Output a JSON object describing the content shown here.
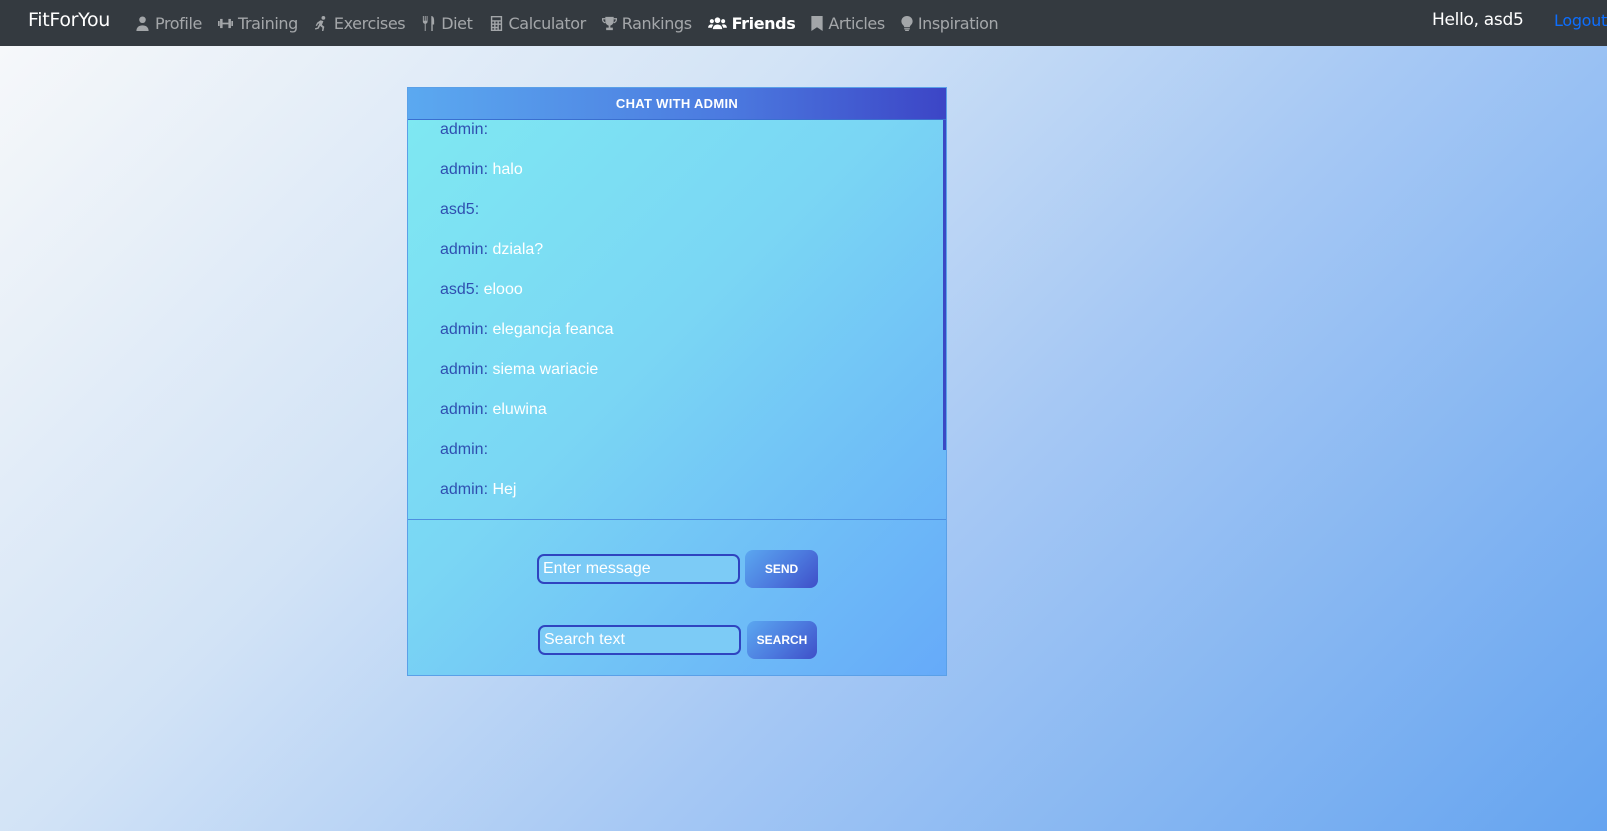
{
  "navbar": {
    "brand": "FitForYou",
    "items": [
      {
        "label": "Profile",
        "icon": "user-icon"
      },
      {
        "label": "Training",
        "icon": "dumbbell-icon"
      },
      {
        "label": "Exercises",
        "icon": "running-icon"
      },
      {
        "label": "Diet",
        "icon": "utensils-icon"
      },
      {
        "label": "Calculator",
        "icon": "calculator-icon"
      },
      {
        "label": "Rankings",
        "icon": "trophy-icon"
      },
      {
        "label": "Friends",
        "icon": "users-icon",
        "active": true
      },
      {
        "label": "Articles",
        "icon": "bookmark-icon"
      },
      {
        "label": "Inspiration",
        "icon": "lightbulb-icon"
      }
    ],
    "greeting": "Hello, asd5",
    "logout": "Logout"
  },
  "chat": {
    "title": "CHAT WITH ADMIN",
    "messages": [
      {
        "user": "admin:",
        "text": ""
      },
      {
        "user": "admin:",
        "text": " halo"
      },
      {
        "user": "asd5:",
        "text": ""
      },
      {
        "user": "admin:",
        "text": " dziala?"
      },
      {
        "user": "asd5:",
        "text": " elooo"
      },
      {
        "user": "admin:",
        "text": " elegancja feanca"
      },
      {
        "user": "admin:",
        "text": " siema wariacie"
      },
      {
        "user": "admin:",
        "text": " eluwina"
      },
      {
        "user": "admin:",
        "text": ""
      },
      {
        "user": "admin:",
        "text": " Hej"
      }
    ],
    "message_input": {
      "placeholder": "Enter message",
      "value": ""
    },
    "send_label": "SEND",
    "search_input": {
      "placeholder": "Search text",
      "value": ""
    },
    "search_label": "SEARCH"
  },
  "colors": {
    "navbar": "#343a40",
    "link": "#0d6efd",
    "header_gradient_end": "#3c45c6",
    "username": "#2f4fb0"
  }
}
